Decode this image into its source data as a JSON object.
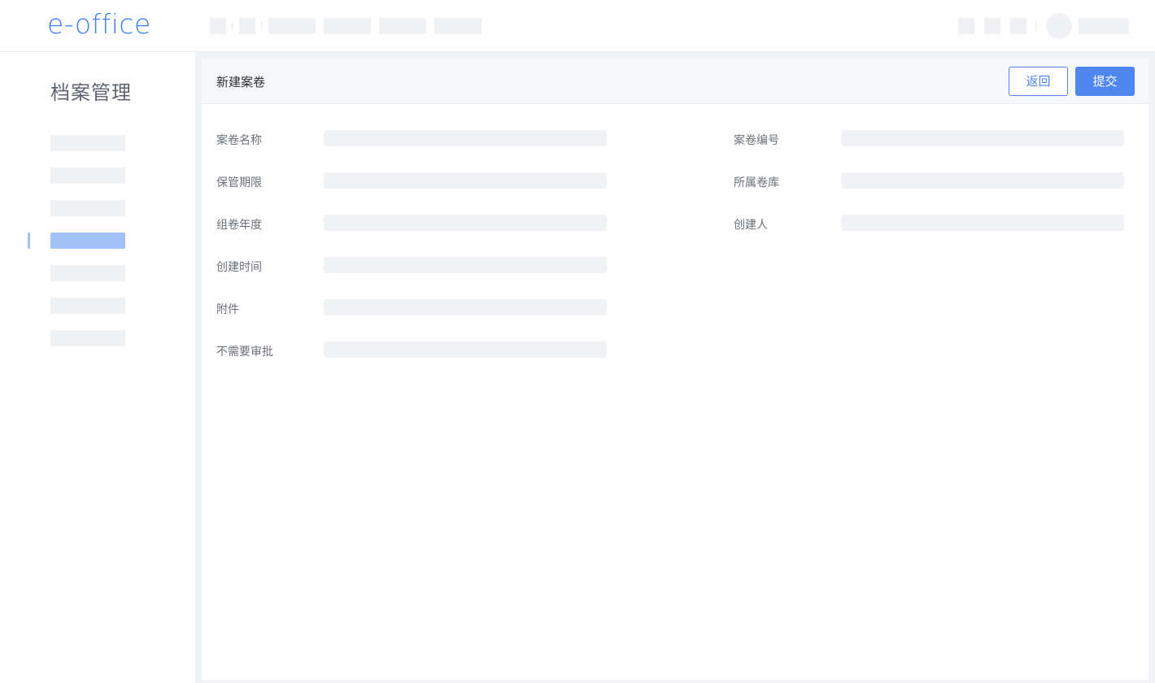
{
  "app": {
    "logo": "e-office"
  },
  "sidebar": {
    "title": "档案管理",
    "active_index": 3
  },
  "card": {
    "title": "新建案卷",
    "back_label": "返回",
    "submit_label": "提交"
  },
  "form": {
    "left": [
      {
        "label": "案卷名称"
      },
      {
        "label": "保管期限"
      },
      {
        "label": "组卷年度"
      },
      {
        "label": "创建时间"
      },
      {
        "label": "附件"
      },
      {
        "label": "不需要审批"
      }
    ],
    "right": [
      {
        "label": "案卷编号"
      },
      {
        "label": "所属卷库"
      },
      {
        "label": "创建人"
      }
    ]
  }
}
